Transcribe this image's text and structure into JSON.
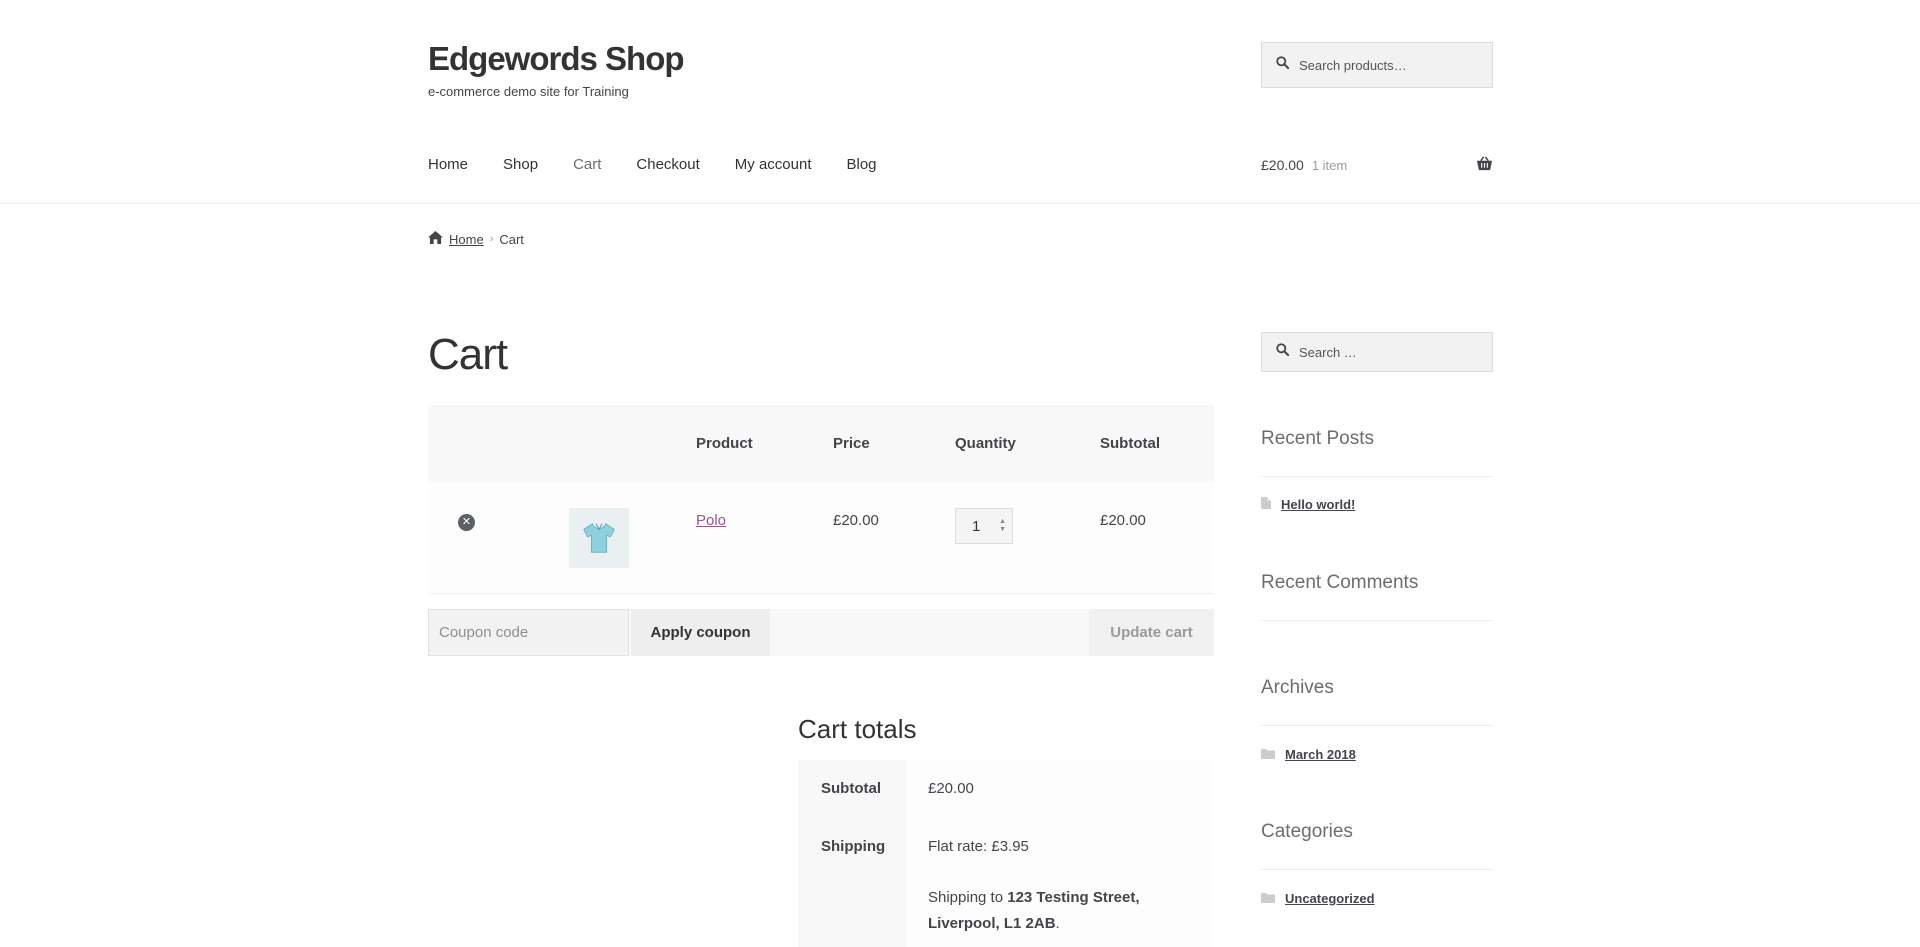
{
  "site": {
    "title": "Edgewords Shop",
    "tagline": "e-commerce demo site for Training"
  },
  "header_search": {
    "placeholder": "Search products…"
  },
  "nav": {
    "items": [
      {
        "label": "Home"
      },
      {
        "label": "Shop"
      },
      {
        "label": "Cart",
        "current": true
      },
      {
        "label": "Checkout"
      },
      {
        "label": "My account"
      },
      {
        "label": "Blog"
      }
    ]
  },
  "mini_cart": {
    "amount": "£20.00",
    "count": "1 item"
  },
  "breadcrumb": {
    "home": "Home",
    "current": "Cart"
  },
  "page": {
    "title": "Cart"
  },
  "cart_table": {
    "headers": {
      "product": "Product",
      "price": "Price",
      "quantity": "Quantity",
      "subtotal": "Subtotal"
    },
    "rows": [
      {
        "product": "Polo",
        "price": "£20.00",
        "quantity": "1",
        "subtotal": "£20.00"
      }
    ]
  },
  "coupon": {
    "placeholder": "Coupon code",
    "apply_label": "Apply coupon",
    "update_label": "Update cart"
  },
  "totals": {
    "title": "Cart totals",
    "subtotal_label": "Subtotal",
    "subtotal_value": "£20.00",
    "shipping_label": "Shipping",
    "shipping_method": "Flat rate: £3.95",
    "shipping_to_prefix": "Shipping to ",
    "shipping_address_1": "123 Testing Street,",
    "shipping_address_2": "Liverpool, L1 2AB",
    "shipping_suffix": "."
  },
  "sidebar": {
    "search_placeholder": "Search …",
    "recent_posts": {
      "title": "Recent Posts",
      "items": [
        "Hello world!"
      ]
    },
    "recent_comments": {
      "title": "Recent Comments"
    },
    "archives": {
      "title": "Archives",
      "items": [
        "March 2018"
      ]
    },
    "categories": {
      "title": "Categories",
      "items": [
        "Uncategorized"
      ]
    }
  },
  "colors": {
    "link_accent": "#96588a",
    "text": "#43454b",
    "heading": "#333333"
  }
}
